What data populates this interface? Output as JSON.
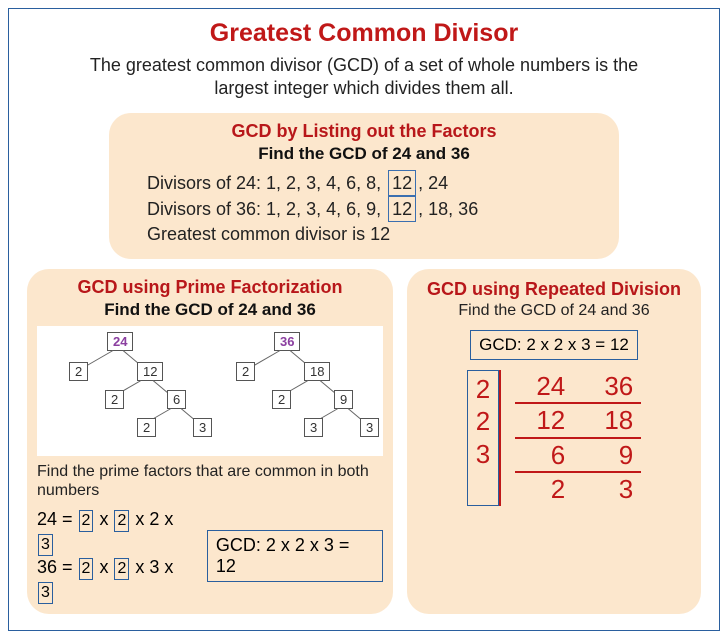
{
  "title": "Greatest Common Divisor",
  "intro": "The greatest common divisor (GCD) of a set of whole numbers is the largest integer which divides them all.",
  "listing": {
    "title": "GCD by Listing out the Factors",
    "subtitle": "Find the GCD of 24 and 36",
    "line1_pre": "Divisors of 24: 1, 2, 3, 4, 6, 8, ",
    "line1_box": "12",
    "line1_post": ", 24",
    "line2_pre": "Divisors of 36: 1, 2, 3, 4, 6, 9, ",
    "line2_box": "12",
    "line2_post": ", 18, 36",
    "result": "Greatest common divisor is 12"
  },
  "prime": {
    "title": "GCD using Prime Factorization",
    "subtitle": "Find the GCD of 24 and 36",
    "tree1": {
      "root": "24",
      "a": "2",
      "b": "12",
      "c": "2",
      "d": "6",
      "e": "2",
      "f": "3"
    },
    "tree2": {
      "root": "36",
      "a": "2",
      "b": "18",
      "c": "2",
      "d": "9",
      "e": "3",
      "f": "3"
    },
    "note": "Find the prime factors that are common in both numbers",
    "eq1_lead": "24 = ",
    "eq1_a": "2",
    "eq1_b": "2",
    "eq1_rest": " x 2 x ",
    "eq1_c": "3",
    "eq2_lead": "36 = ",
    "eq2_a": "2",
    "eq2_b": "2",
    "eq2_rest": " x 3 x ",
    "eq2_c": "3",
    "mul": " x ",
    "gcd_box": "GCD: 2 x 2 x 3 = 12"
  },
  "repeated": {
    "title": "GCD using Repeated Division",
    "subtitle": "Find the GCD of 24 and 36",
    "gcd_box": "GCD: 2 x 2 x 3 = 12",
    "divisors": [
      "2",
      "2",
      "3"
    ],
    "rows": [
      [
        "24",
        "36"
      ],
      [
        "12",
        "18"
      ],
      [
        "6",
        "9"
      ],
      [
        "2",
        "3"
      ]
    ]
  }
}
